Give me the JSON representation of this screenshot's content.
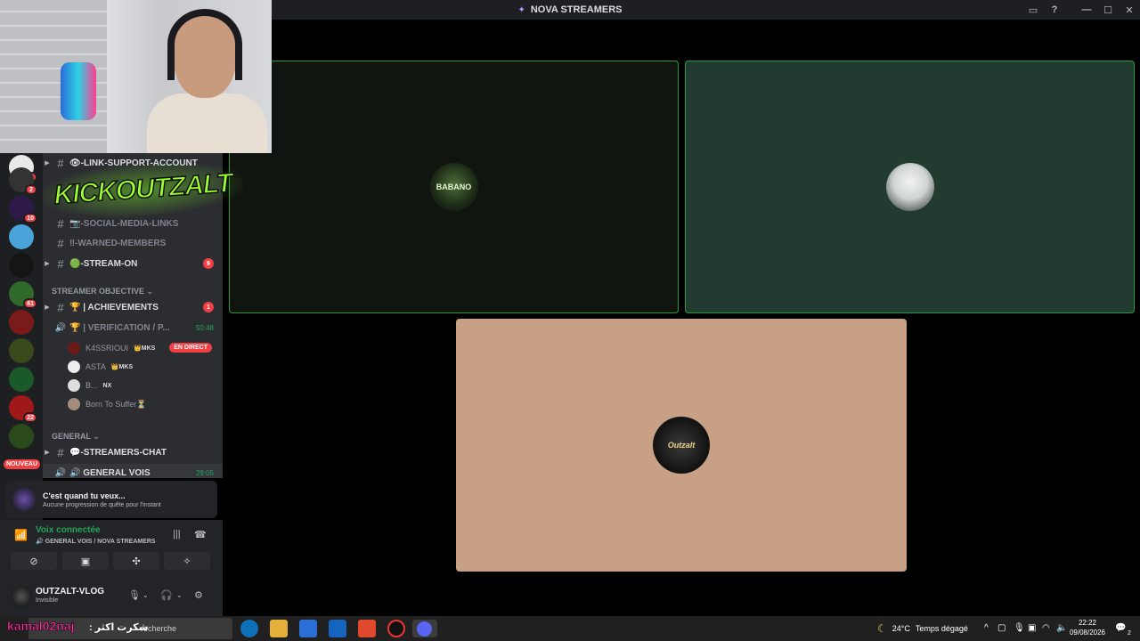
{
  "app": {
    "title": "NOVA STREAMERS",
    "title_icon": "sparkle-icon"
  },
  "window_controls": {
    "inbox": "▭",
    "help": "?",
    "minimize": "—",
    "maximize": "☐",
    "close": "✕"
  },
  "servers": {
    "badges": [
      "3",
      "2",
      "10",
      "61",
      "22"
    ],
    "nouveau": "NOUVEAU"
  },
  "channels": {
    "items": [
      {
        "name": "👁-LINK-SUPPORT-ACCOUNT"
      },
      {
        "name": "📷-SOCIAL-MEDIA-LINKS"
      },
      {
        "name": "‼-WARNED-MEMBERS"
      },
      {
        "name": "🟢-STREAM-ON",
        "count": "9"
      }
    ],
    "category_objective": "STREAMER OBJECTIVE ⌄",
    "achievements": {
      "name": "🏆 | ACHIEVEMENTS",
      "count": "1"
    },
    "verification": {
      "name": "🏆 | VERIFICATION / P...",
      "time": "50:48"
    },
    "voice_users": [
      {
        "name": "K4SSRIOUI",
        "tag": "👑MKS",
        "live": "EN DIRECT"
      },
      {
        "name": "ASTA",
        "tag": "👑MKS"
      },
      {
        "name": "B...",
        "tag": "NX"
      },
      {
        "name": "Born To Suffer⏳"
      }
    ],
    "category_general": "GENERAL ⌄",
    "streamers_chat": "💬-STREAMERS-CHAT",
    "general_vois": {
      "name": "🔊 GENERAL VOIS",
      "time": "29:05"
    }
  },
  "overlay_logo": "KICKOUTZALT",
  "quest": {
    "title": "C'est quand tu veux...",
    "subtitle": "Aucune progression de quête pour l'instant"
  },
  "voice": {
    "status": "Voix connectée",
    "channel": "🔊 GENERAL VOIS / NOVA STREAMERS"
  },
  "user": {
    "name": "OUTZALT-VLOG",
    "status": "Invisible"
  },
  "tiles": [
    {
      "label": "BABANO"
    },
    {
      "label": ""
    },
    {
      "label": "Outzalt"
    }
  ],
  "taskbar": {
    "search_placeholder": "recherche",
    "overlay_handle": "kamal02naj",
    "overlay_arabic": ": شكرت اكثر",
    "weather_temp": "24°C",
    "weather_text": "Temps dégagé",
    "time": "22:22",
    "date": "09/08/2026",
    "notification_count": "2"
  }
}
